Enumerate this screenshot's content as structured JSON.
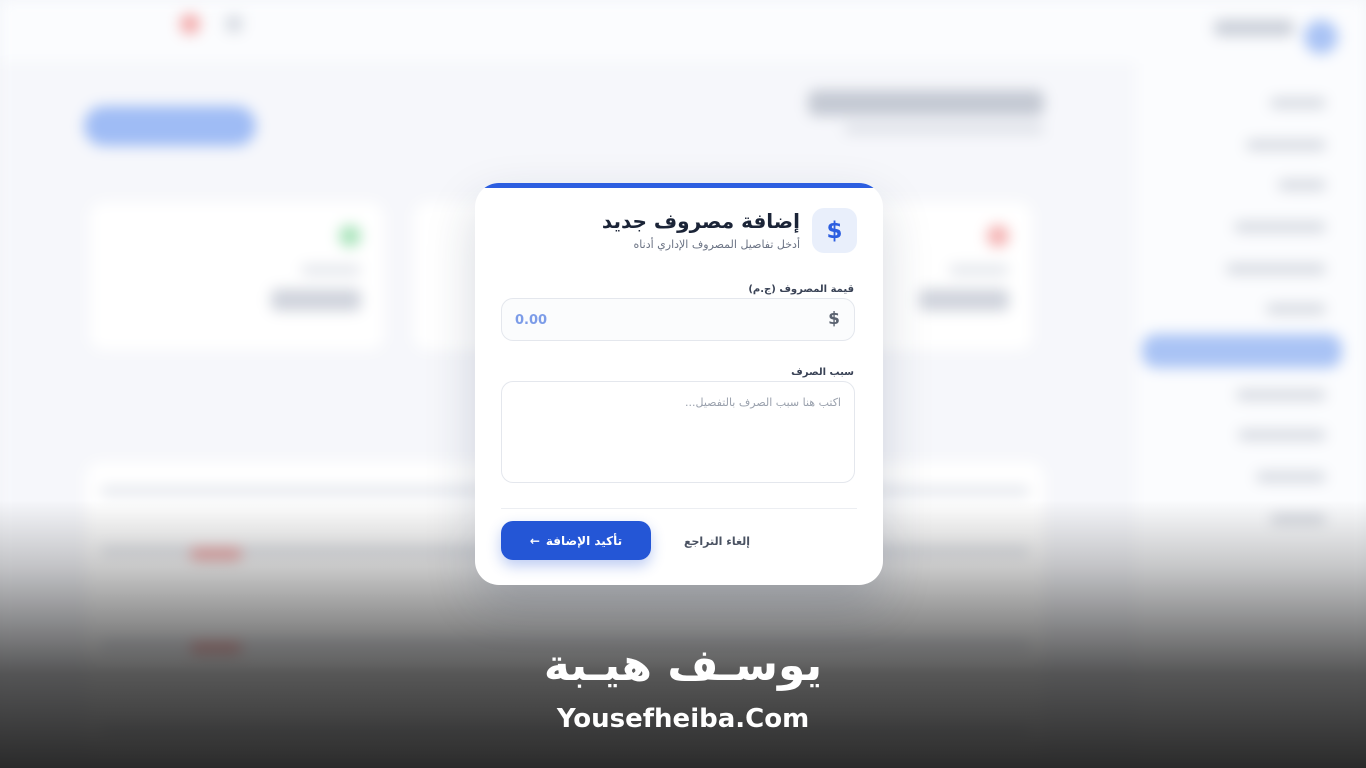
{
  "modal": {
    "icon": "dollar-icon",
    "title": "إضافة مصروف جديد",
    "subtitle": "أدخل تفاصيل المصروف الإداري أدناه",
    "amount": {
      "label": "قيمة المصروف (ج.م)",
      "currency_symbol": "$",
      "value": "0.00"
    },
    "reason": {
      "label": "سبب الصرف",
      "placeholder": "اكتب هنا سبب الصرف بالتفصيل..."
    },
    "buttons": {
      "confirm": "تأكيد الإضافة",
      "confirm_icon": "arrow-left-icon",
      "cancel": "إلغاء التراجع"
    },
    "colors": {
      "accent": "#2c5ee0",
      "button": "#2456d6"
    }
  },
  "watermark": {
    "arabic": "يوسـف هيـبة",
    "english": "Yousefheiba.Com"
  }
}
